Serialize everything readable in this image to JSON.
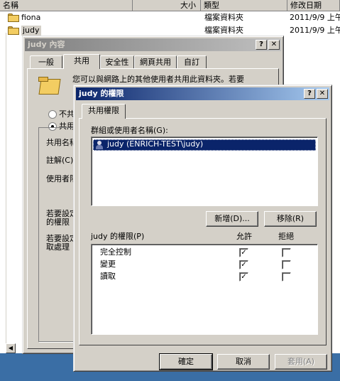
{
  "explorer": {
    "columns": [
      "名稱",
      "大小",
      "類型",
      "修改日期"
    ],
    "rows": [
      {
        "name": "fiona",
        "type": "檔案資料夾",
        "date": "2011/9/9 上午"
      },
      {
        "name": "judy",
        "type": "檔案資料夾",
        "date": "2011/9/9 上午"
      }
    ]
  },
  "properties": {
    "title": "judy 內容",
    "tabs": [
      "一般",
      "共用",
      "安全性",
      "網頁共用",
      "自訂"
    ],
    "intro": "您可以與網路上的其他使用者共用此資料夾。若要",
    "radio_off": "不共",
    "radio_on": "共用",
    "fields": [
      "共用名稱",
      "註解(C)",
      "使用者限"
    ],
    "note1": [
      "若要設定",
      "的權限"
    ],
    "note2": [
      "若要設定",
      "取處理"
    ]
  },
  "permissions": {
    "title": "judy 的權限",
    "tab": "共用權限",
    "group_label": "群組或使用者名稱(G):",
    "users": [
      "judy (ENRICH-TEST\\judy)"
    ],
    "add_button": "新增(D)...",
    "remove_button": "移除(R)",
    "perm_label": "judy 的權限(P)",
    "allow_header": "允許",
    "deny_header": "拒絕",
    "perms": [
      {
        "name": "完全控制",
        "allow": true,
        "deny": false
      },
      {
        "name": "變更",
        "allow": true,
        "deny": false
      },
      {
        "name": "讀取",
        "allow": true,
        "deny": false
      }
    ],
    "ok_button": "確定",
    "cancel_button": "取消",
    "apply_button": "套用(A)"
  },
  "titlebar_buttons": {
    "help": "?",
    "close": "✕"
  },
  "check_glyph": "✓"
}
